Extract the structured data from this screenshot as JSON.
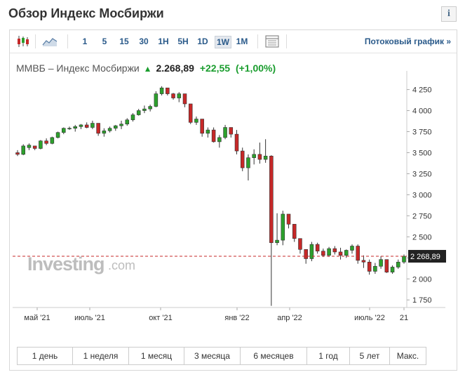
{
  "page": {
    "title": "Обзор Индекс Мосбиржи",
    "info_label": "i"
  },
  "toolbar": {
    "intervals": [
      "1",
      "5",
      "15",
      "30",
      "1H",
      "5H",
      "1D",
      "1W",
      "1M"
    ],
    "active_interval": "1W",
    "stream_label": "Потоковый график »"
  },
  "quote": {
    "name": "ММВБ – Индекс Мосбиржи",
    "last": "2.268,89",
    "change": "+22,55",
    "change_pct": "(+1,00%)",
    "direction": "up",
    "color_up": "#1a9d2e"
  },
  "watermark": {
    "brand": "Investing",
    "suffix": ".com"
  },
  "chart_data": {
    "type": "candlestick",
    "y_ticks": [
      "4 250",
      "4 000",
      "3 750",
      "3 500",
      "3 250",
      "3 000",
      "2 750",
      "2 500",
      "2 250",
      "2 000",
      "1 750"
    ],
    "y_tick_values": [
      4250,
      4000,
      3750,
      3500,
      3250,
      3000,
      2750,
      2500,
      2250,
      2000,
      1750
    ],
    "x_ticks": [
      "май '21",
      "июль '21",
      "окт '21",
      "янв '22",
      "апр '22",
      "июль '22",
      "21"
    ],
    "ylim": [
      1660,
      4330
    ],
    "current_value_label": "2 268,89",
    "current_value": 2268.89,
    "up_color": "#2ca02c",
    "down_color": "#c62828",
    "candles": [
      [
        3500,
        3530,
        3460,
        3480
      ],
      [
        3480,
        3600,
        3470,
        3580
      ],
      [
        3560,
        3610,
        3530,
        3590
      ],
      [
        3580,
        3570,
        3530,
        3550
      ],
      [
        3550,
        3650,
        3540,
        3640
      ],
      [
        3640,
        3670,
        3590,
        3610
      ],
      [
        3610,
        3690,
        3600,
        3680
      ],
      [
        3680,
        3750,
        3670,
        3740
      ],
      [
        3740,
        3800,
        3720,
        3790
      ],
      [
        3790,
        3810,
        3770,
        3790
      ],
      [
        3790,
        3830,
        3750,
        3810
      ],
      [
        3810,
        3840,
        3780,
        3830
      ],
      [
        3830,
        3860,
        3790,
        3800
      ],
      [
        3800,
        3880,
        3780,
        3850
      ],
      [
        3850,
        3830,
        3700,
        3730
      ],
      [
        3730,
        3790,
        3690,
        3760
      ],
      [
        3760,
        3810,
        3740,
        3790
      ],
      [
        3790,
        3830,
        3760,
        3820
      ],
      [
        3820,
        3880,
        3780,
        3840
      ],
      [
        3840,
        3910,
        3820,
        3890
      ],
      [
        3890,
        3970,
        3870,
        3950
      ],
      [
        3950,
        4020,
        3940,
        4000
      ],
      [
        4000,
        4060,
        3970,
        4020
      ],
      [
        4020,
        4070,
        3990,
        4050
      ],
      [
        4050,
        4230,
        4040,
        4200
      ],
      [
        4200,
        4290,
        4180,
        4270
      ],
      [
        4270,
        4250,
        4180,
        4200
      ],
      [
        4200,
        4210,
        4130,
        4150
      ],
      [
        4150,
        4220,
        4100,
        4200
      ],
      [
        4200,
        4140,
        4040,
        4080
      ],
      [
        4080,
        4060,
        3840,
        3860
      ],
      [
        3860,
        3930,
        3830,
        3900
      ],
      [
        3900,
        3850,
        3690,
        3730
      ],
      [
        3730,
        3800,
        3680,
        3770
      ],
      [
        3770,
        3800,
        3620,
        3630
      ],
      [
        3630,
        3710,
        3560,
        3680
      ],
      [
        3680,
        3830,
        3660,
        3800
      ],
      [
        3800,
        3790,
        3680,
        3720
      ],
      [
        3720,
        3770,
        3480,
        3520
      ],
      [
        3520,
        3560,
        3280,
        3320
      ],
      [
        3320,
        3480,
        3170,
        3440
      ],
      [
        3440,
        3540,
        3360,
        3480
      ],
      [
        3480,
        3620,
        3370,
        3420
      ],
      [
        3420,
        3660,
        3380,
        3460
      ],
      [
        3460,
        3470,
        1680,
        2430
      ],
      [
        2430,
        2780,
        2400,
        2460
      ],
      [
        2460,
        2810,
        2400,
        2770
      ],
      [
        2770,
        2750,
        2600,
        2650
      ],
      [
        2650,
        2640,
        2440,
        2480
      ],
      [
        2480,
        2440,
        2300,
        2350
      ],
      [
        2350,
        2320,
        2180,
        2240
      ],
      [
        2240,
        2440,
        2210,
        2410
      ],
      [
        2410,
        2430,
        2300,
        2330
      ],
      [
        2330,
        2360,
        2260,
        2280
      ],
      [
        2280,
        2380,
        2260,
        2360
      ],
      [
        2360,
        2390,
        2290,
        2320
      ],
      [
        2320,
        2370,
        2230,
        2280
      ],
      [
        2280,
        2350,
        2250,
        2340
      ],
      [
        2340,
        2410,
        2300,
        2390
      ],
      [
        2390,
        2410,
        2180,
        2220
      ],
      [
        2220,
        2280,
        2130,
        2200
      ],
      [
        2200,
        2230,
        2050,
        2090
      ],
      [
        2090,
        2190,
        2060,
        2150
      ],
      [
        2150,
        2270,
        2120,
        2230
      ],
      [
        2230,
        2220,
        2070,
        2080
      ],
      [
        2080,
        2160,
        2060,
        2140
      ],
      [
        2140,
        2230,
        2120,
        2200
      ],
      [
        2200,
        2290,
        2180,
        2269
      ]
    ]
  },
  "ranges": [
    "1 день",
    "1 неделя",
    "1 месяц",
    "3 месяца",
    "6 месяцев",
    "1 год",
    "5 лет",
    "Макс."
  ]
}
